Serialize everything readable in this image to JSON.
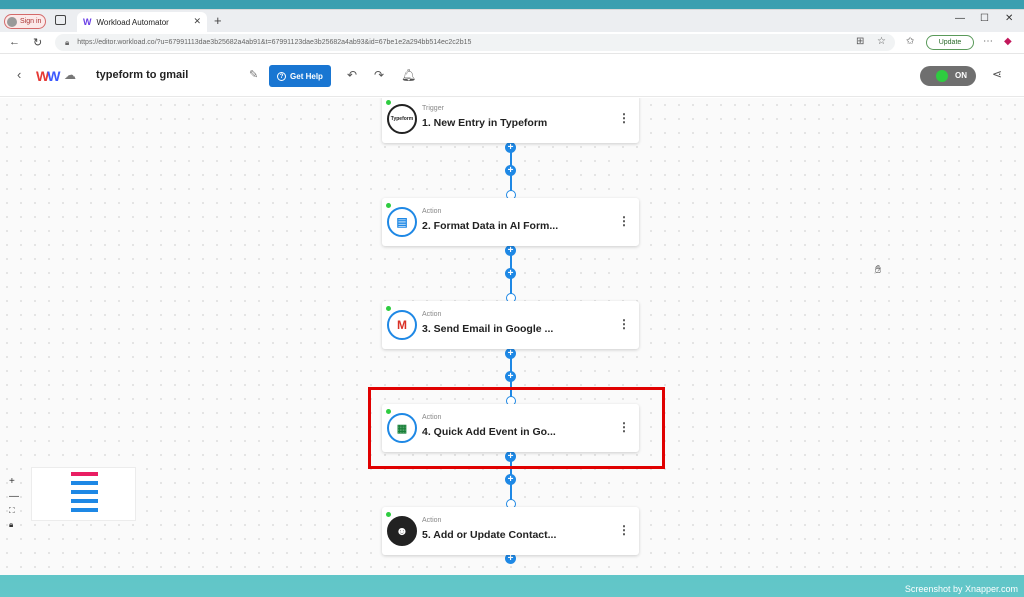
{
  "browser": {
    "sign_in": "Sign in",
    "tab_title": "Workload Automator",
    "url": "https://editor.workload.co/?u=67991113dae3b25682a4ab91&t=67991123dae3b25682a4ab93&id=67be1e2a294bb514ec2c2b15",
    "update_label": "Update"
  },
  "header": {
    "workflow_name": "typeform to gmail",
    "help_label": "Get Help",
    "toggle_label": "ON"
  },
  "steps": [
    {
      "kind": "Trigger",
      "title": "1. New Entry in Typeform",
      "icon": "typeform-icon"
    },
    {
      "kind": "Action",
      "title": "2. Format Data in AI Form...",
      "icon": "formatter-icon"
    },
    {
      "kind": "Action",
      "title": "3. Send Email in Google ...",
      "icon": "gmail-icon"
    },
    {
      "kind": "Action",
      "title": "4. Quick Add Event in Go...",
      "icon": "google-calendar-icon"
    },
    {
      "kind": "Action",
      "title": "5. Add or Update Contact...",
      "icon": "mailchimp-icon"
    }
  ],
  "colors": {
    "accent": "#1e88e5",
    "highlight": "#e00000",
    "status_on": "#2ecc40"
  },
  "watermark": "Screenshot by Xnapper.com"
}
